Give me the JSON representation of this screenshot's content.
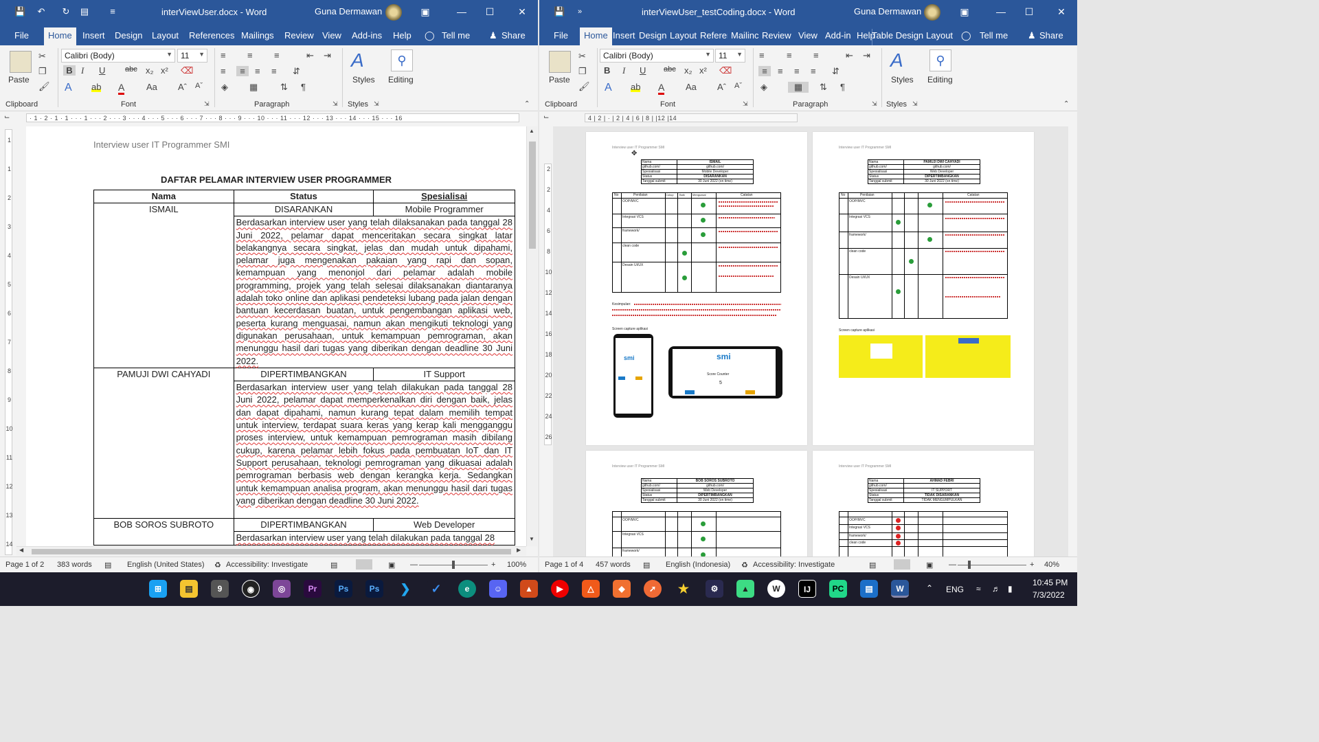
{
  "left": {
    "quick_access": {
      "save_icon": "save-icon",
      "undo_icon": "undo-icon",
      "redo_icon": "redo-icon"
    },
    "title": "interViewUser.docx  -  Word",
    "user": "Guna Dermawan",
    "tabs": [
      "File",
      "Home",
      "Insert",
      "Design",
      "Layout",
      "References",
      "Mailings",
      "Review",
      "View",
      "Add-ins",
      "Help",
      "Tell me",
      "Share"
    ],
    "ribbon": {
      "paste": "Paste",
      "font_name": "Calibri (Body)",
      "font_size": "11",
      "styles": "Styles",
      "editing": "Editing",
      "groups": [
        "Clipboard",
        "Font",
        "Paragraph",
        "Styles"
      ]
    },
    "ruler": "· 1 · 2 · 1 · 1 · · · 1 · · · 2 · · · 3 · · · 4 · · · 5 · · · 6 · · · 7 · · · 8 · · · 9 · · · 10 · · · 11 · · · 12 · · · 13 · · · 14 · · · 15 · · · 16",
    "vruler": [
      "1",
      "1",
      "2",
      "3",
      "4",
      "5",
      "6",
      "7",
      "8",
      "9",
      "10",
      "11",
      "12",
      "13",
      "14"
    ],
    "doc": {
      "header": "Interview user IT Programmer SMI",
      "heading": "DAFTAR PELAMAR INTERVIEW USER PROGRAMMER",
      "columns": [
        "Nama",
        "Status",
        "Spesialisai"
      ],
      "rows": [
        {
          "name": "ISMAIL",
          "status": "DISARANKAN",
          "spec": "Mobile Programmer",
          "note": "Berdasarkan interview user yang telah dilaksanakan pada tanggal 28 Juni 2022, pelamar dapat menceritakan secara singkat latar belakangnya secara singkat, jelas dan mudah untuk dipahami, pelamar juga mengenakan pakaian yang rapi dan sopan, kemampuan yang menonjol dari pelamar adalah mobile programming, projek yang telah selesai dilaksanakan diantaranya adalah toko online dan aplikasi pendeteksi lubang pada jalan dengan bantuan kecerdasan buatan, untuk pengembangan aplikasi web, peserta kurang menguasai, namun akan mengikuti teknologi yang digunakan perusahaan, untuk kemampuan pemrograman, akan menunggu hasil dari tugas yang diberikan dengan deadline 30 Juni 2022."
        },
        {
          "name": "PAMUJI DWI CAHYADI",
          "status": "DIPERTIMBANGKAN",
          "spec": "IT Support",
          "note": "Berdasarkan interview user yang telah dilakukan pada tanggal 28 Juni 2022, pelamar dapat memperkenalkan diri dengan baik, jelas dan dapat dipahami, namun kurang tepat dalam memilih tempat untuk interview, terdapat suara keras yang kerap kali mengganggu proses interview, untuk kemampuan pemrograman masih dibilang cukup, karena pelamar lebih fokus pada pembuatan IoT dan IT Support perusahaan, teknologi pemrograman yang dikuasai adalah pemrograman berbasis web dengan kerangka kerja. Sedangkan untuk kemampuan analisa program, akan menunggu hasil dari tugas yang diberikan dengan deadline 30 Juni 2022."
        },
        {
          "name": "BOB SOROS SUBROTO",
          "status": "DIPERTIMBANGKAN",
          "spec": "Web Developer",
          "note": "Berdasarkan interview user yang telah dilakukan pada tanggal 28"
        }
      ]
    },
    "status": {
      "page": "Page 1 of 2",
      "words": "383 words",
      "lang": "English (United States)",
      "access": "Accessibility: Investigate",
      "zoom": "100%"
    }
  },
  "right": {
    "title": "interViewUser_testCoding.docx  -  Word",
    "user": "Guna Dermawan",
    "tabs": [
      "File",
      "Home",
      "Insert",
      "Design",
      "Layout",
      "Referer",
      "Mailinc",
      "Review",
      "View",
      "Add-in",
      "Help",
      "Table Design",
      "Layout",
      "Tell me",
      "Share"
    ],
    "ribbon": {
      "paste": "Paste",
      "font_name": "Calibri (Body)",
      "font_size": "11",
      "styles": "Styles",
      "editing": "Editing",
      "groups": [
        "Clipboard",
        "Font",
        "Paragraph",
        "Styles"
      ]
    },
    "ruler": "4 | 2 |  ·  | 2 | 4 |  6 |  8 |  |12 |14",
    "vruler": [
      "2",
      "2",
      "4",
      "6",
      "8",
      "10",
      "12",
      "14",
      "16",
      "18",
      "20",
      "22",
      "24",
      "26"
    ],
    "pages": [
      {
        "header": "Interview user IT Programmer SMI",
        "name": "ISMAIL",
        "spec": "Mobile Developer",
        "status": "DISARANKAN",
        "date": "30 Juni 2022 (on time)",
        "kesimpulan": "Kesimpulan:",
        "screen": "Screen capture aplikasi",
        "score": "Score Counter",
        "value": "5"
      },
      {
        "header": "Interview user IT Programmer SMI",
        "name": "PAMUJI DWI CAHYADI",
        "spec": "Web Developer",
        "status": "DIPERTIMBANGKAN",
        "date": "30 Juni 2022 (on time)",
        "screen": "Screen capture aplikasi"
      },
      {
        "header": "Interview user IT Programmer SMI",
        "name": "BOB SOROS SUBROTO",
        "spec": "Web Developer",
        "status": "DIPERTIMBANGKAN",
        "date": "30 Juni 2022 (on time)"
      },
      {
        "header": "Interview user IT Programmer SMI",
        "name": "AHMAD FEBRI",
        "spec": "IT SUPPORT",
        "status": "TIDAK DISARANKAN",
        "date": "TIDAK MENGUMPULKAN"
      }
    ],
    "mini_labels": {
      "name": "Nama",
      "github": "github.com/",
      "spec": "Spesialisasi",
      "status": "Status",
      "submit": "Tanggal submit",
      "no": "No",
      "penilaian": "Penilaian",
      "cukup": "Cukup",
      "baik": "Baik",
      "menguasai": "Menguasai",
      "catatan": "Catatan"
    },
    "criteria": [
      "OOP/MVC",
      "Integrasi VCS",
      "framework/",
      "clean code",
      "Desain UI/UX"
    ],
    "status": {
      "page": "Page 1 of 4",
      "words": "457 words",
      "lang": "English (Indonesia)",
      "access": "Accessibility: Investigate",
      "zoom": "40%"
    }
  },
  "taskbar": {
    "lang": "ENG",
    "time": "10:45 PM",
    "date": "7/3/2022",
    "apps": [
      "windows-icon",
      "file-explorer-icon",
      "app-9-icon",
      "github-icon",
      "tor-icon",
      "premiere-icon",
      "photoshop-icon",
      "photoshop-ps-icon",
      "vscode-icon",
      "todo-icon",
      "edge-icon",
      "discord-icon",
      "app-icon",
      "youtube-icon",
      "brave-icon",
      "git-icon",
      "postman-icon",
      "star-icon",
      "settings-icon",
      "android-icon",
      "whatsapp-icon",
      "intellij-icon",
      "pycharm-icon",
      "reader-icon",
      "word-icon"
    ]
  }
}
